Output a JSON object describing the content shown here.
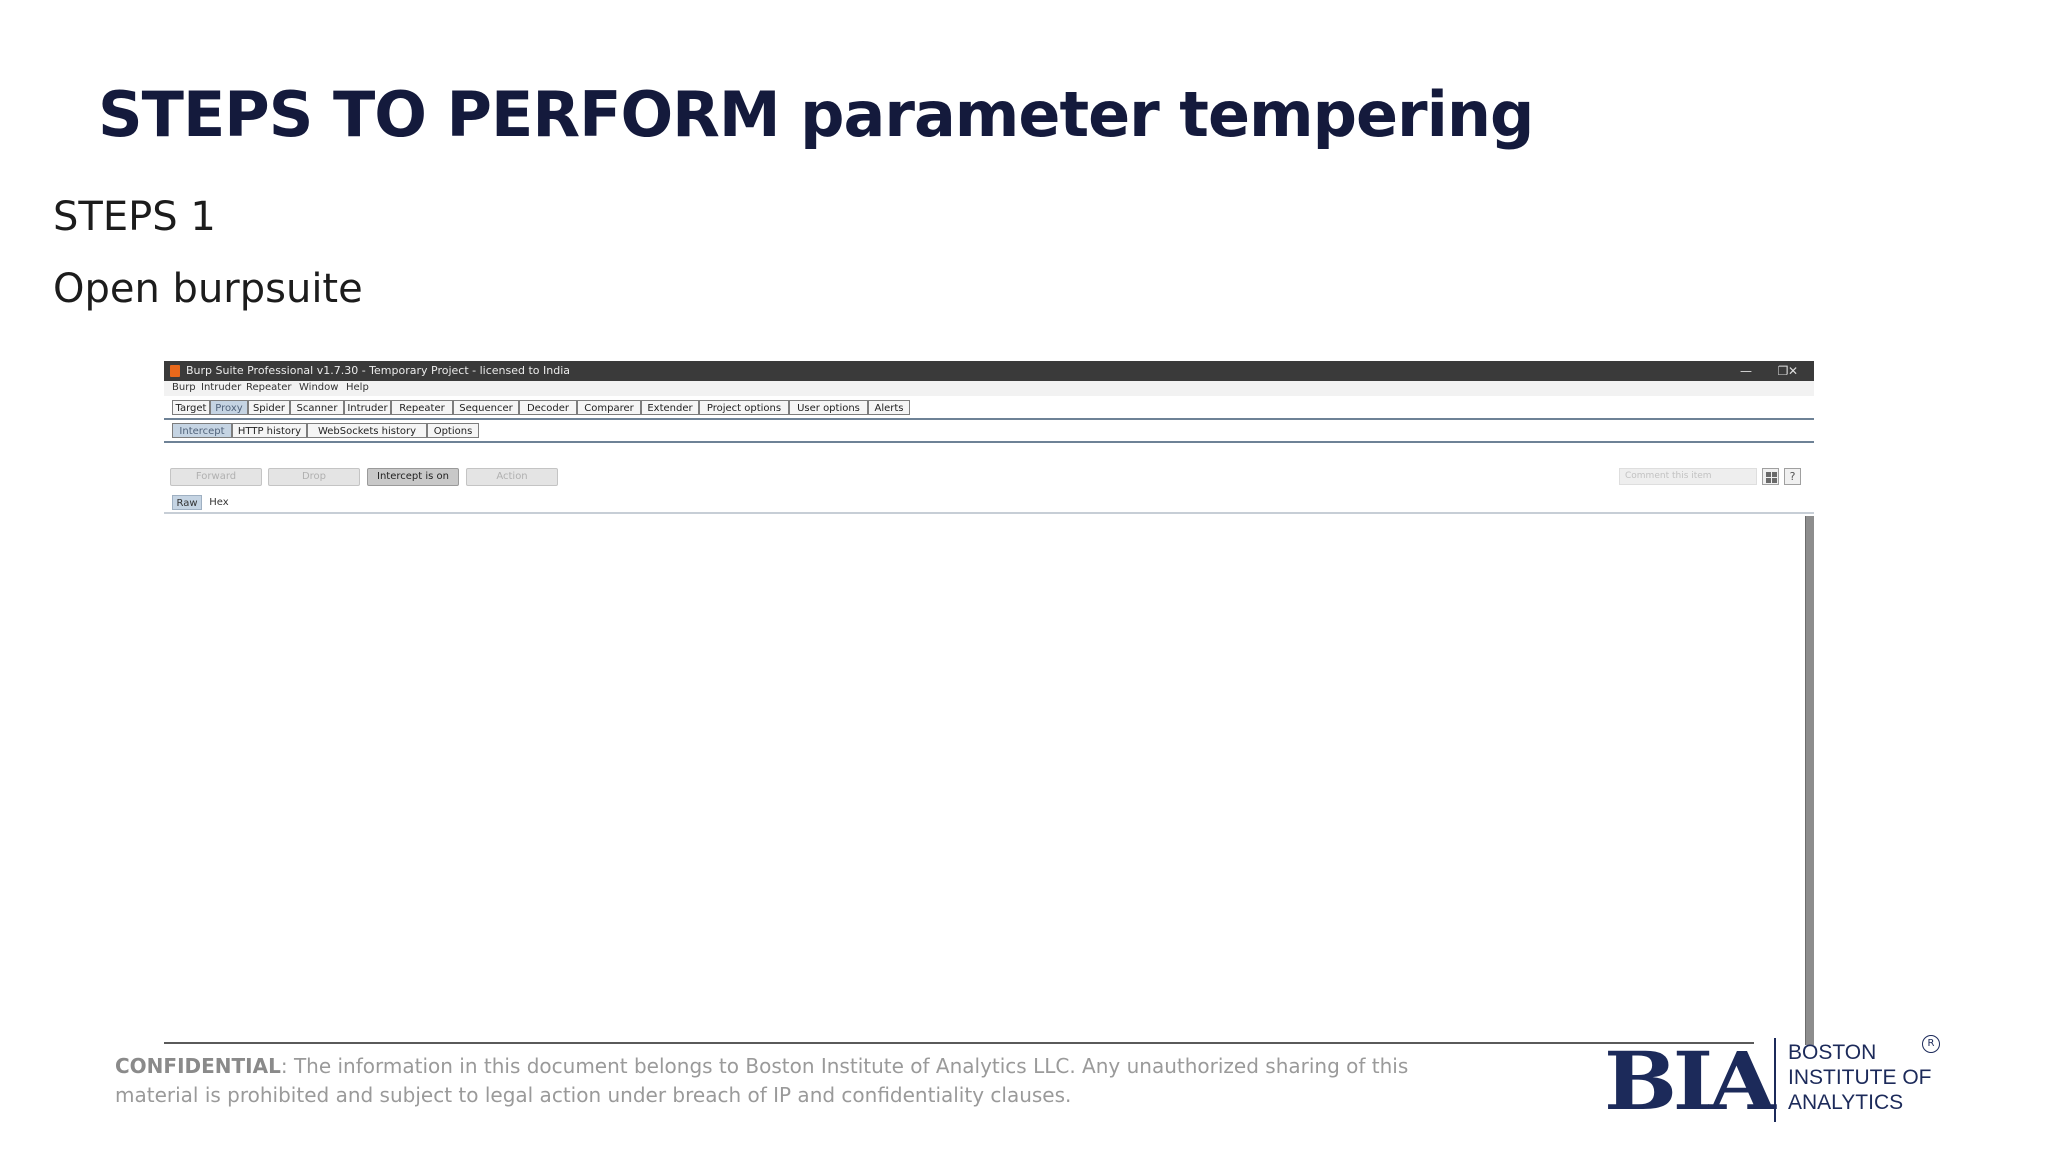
{
  "slide": {
    "title": "STEPS TO PERFORM parameter tempering",
    "step_number": "STEPS 1",
    "step_text": "Open burpsuite"
  },
  "burp": {
    "window_title": "Burp Suite Professional v1.7.30 - Temporary Project - licensed to India",
    "window_controls": {
      "minimize": "—",
      "restore": "❐",
      "close": "✕"
    },
    "menu": [
      "Burp",
      "Intruder",
      "Repeater",
      "Window",
      "Help"
    ],
    "main_tabs": [
      "Target",
      "Proxy",
      "Spider",
      "Scanner",
      "Intruder",
      "Repeater",
      "Sequencer",
      "Decoder",
      "Comparer",
      "Extender",
      "Project options",
      "User options",
      "Alerts"
    ],
    "main_tab_selected": "Proxy",
    "proxy_tabs": [
      "Intercept",
      "HTTP history",
      "WebSockets history",
      "Options"
    ],
    "proxy_tab_selected": "Intercept",
    "buttons": {
      "forward": "Forward",
      "drop": "Drop",
      "intercept": "Intercept is on",
      "action": "Action"
    },
    "comment_placeholder": "Comment this item",
    "help_icon": "?",
    "view_tabs": [
      "Raw",
      "Hex"
    ],
    "view_tab_selected": "Raw"
  },
  "footer": {
    "label": "CONFIDENTIAL",
    "text": ": The information in this document belongs to Boston Institute of Analytics LLC. Any unauthorized sharing of this material is prohibited and subject to legal action under breach of IP and confidentiality clauses."
  },
  "logo": {
    "mark": "BIA",
    "text": "BOSTON\nINSTITUTE OF\nANALYTICS",
    "registered": "R"
  },
  "colors": {
    "title": "#141a3c",
    "brand": "#1c2a5a",
    "burp_titlebar": "#3a3a3a",
    "tab_selected": "#c5d4e3"
  }
}
